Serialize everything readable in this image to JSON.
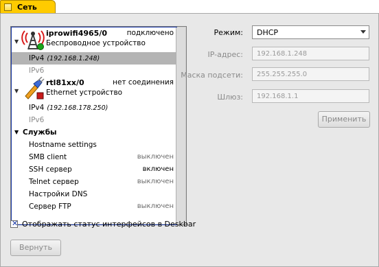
{
  "tab": {
    "title": "Сеть"
  },
  "interfaces": [
    {
      "name": "iprowifi4965/0",
      "status": "подключено",
      "type": "Беспроводное устройство",
      "icon": "wifi-tower-icon",
      "status_color": "#1aa81a",
      "subitems": [
        {
          "label": "IPv4",
          "address": "(192.168.1.248)",
          "selected": true
        },
        {
          "label": "IPv6",
          "address": "",
          "selected": false
        }
      ]
    },
    {
      "name": "rtl81xx/0",
      "status": "нет соединения",
      "type": "Ethernet устройство",
      "icon": "ethernet-plug-icon",
      "status_color": "#c81a1a",
      "subitems": [
        {
          "label": "IPv4",
          "address": "(192.168.178.250)",
          "selected": false
        },
        {
          "label": "IPv6",
          "address": "",
          "selected": false
        }
      ]
    }
  ],
  "services": {
    "header": "Службы",
    "items": [
      {
        "label": "Hostname settings",
        "status": ""
      },
      {
        "label": "SMB client",
        "status": "выключен"
      },
      {
        "label": "SSH сервер",
        "status": "включен"
      },
      {
        "label": "Telnet сервер",
        "status": "выключен"
      },
      {
        "label": "Настройки DNS",
        "status": ""
      },
      {
        "label": "Сервер FTP",
        "status": "выключен"
      }
    ]
  },
  "form": {
    "mode_label": "Режим:",
    "mode_value": "DHCP",
    "ip_label": "IP-адрес:",
    "ip_value": "192.168.1.248",
    "mask_label": "Маска подсети:",
    "mask_value": "255.255.255.0",
    "gateway_label": "Шлюз:",
    "gateway_value": "192.168.1.1",
    "apply_label": "Применить"
  },
  "deskbar_checkbox": {
    "label": "Отображать статус интерфейсов в Deskbar",
    "checked": true
  },
  "revert_label": "Вернуть"
}
